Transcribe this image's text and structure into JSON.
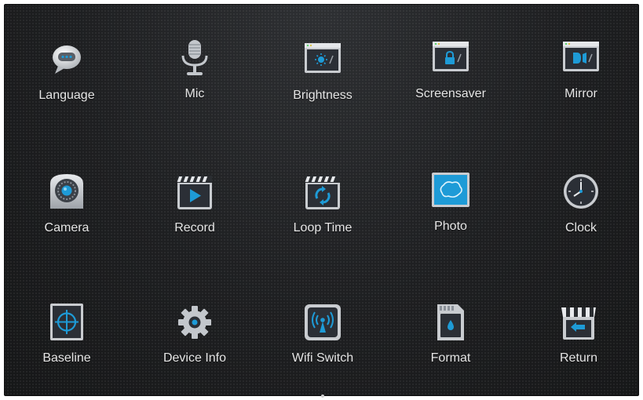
{
  "menu": {
    "items": [
      {
        "label": "Language",
        "icon": "speech-bubble-icon"
      },
      {
        "label": "Mic",
        "icon": "microphone-icon"
      },
      {
        "label": "Brightness",
        "icon": "brightness-icon"
      },
      {
        "label": "Screensaver",
        "icon": "lock-screen-icon"
      },
      {
        "label": "Mirror",
        "icon": "mirror-icon"
      },
      {
        "label": "Camera",
        "icon": "camera-icon"
      },
      {
        "label": "Record",
        "icon": "record-icon"
      },
      {
        "label": "Loop Time",
        "icon": "loop-icon"
      },
      {
        "label": "Photo",
        "icon": "photo-icon"
      },
      {
        "label": "Clock",
        "icon": "clock-icon"
      },
      {
        "label": "Baseline",
        "icon": "crosshair-icon"
      },
      {
        "label": "Device Info",
        "icon": "gear-icon"
      },
      {
        "label": "Wifi Switch",
        "icon": "wifi-icon"
      },
      {
        "label": "Format",
        "icon": "sd-card-icon"
      },
      {
        "label": "Return",
        "icon": "return-icon"
      }
    ]
  },
  "colors": {
    "background": "#1d1e20",
    "accent": "#1e9bd7",
    "icon_frame": "#c9ccd0",
    "label": "#e6e6e6"
  }
}
